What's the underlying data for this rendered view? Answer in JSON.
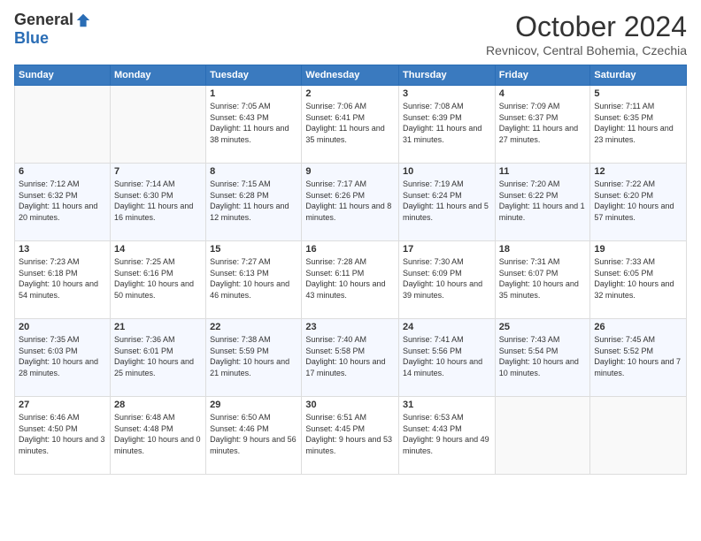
{
  "header": {
    "logo_general": "General",
    "logo_blue": "Blue",
    "title": "October 2024",
    "subtitle": "Revnicov, Central Bohemia, Czechia"
  },
  "days_of_week": [
    "Sunday",
    "Monday",
    "Tuesday",
    "Wednesday",
    "Thursday",
    "Friday",
    "Saturday"
  ],
  "weeks": [
    [
      {
        "day": "",
        "sunrise": "",
        "sunset": "",
        "daylight": ""
      },
      {
        "day": "",
        "sunrise": "",
        "sunset": "",
        "daylight": ""
      },
      {
        "day": "1",
        "sunrise": "Sunrise: 7:05 AM",
        "sunset": "Sunset: 6:43 PM",
        "daylight": "Daylight: 11 hours and 38 minutes."
      },
      {
        "day": "2",
        "sunrise": "Sunrise: 7:06 AM",
        "sunset": "Sunset: 6:41 PM",
        "daylight": "Daylight: 11 hours and 35 minutes."
      },
      {
        "day": "3",
        "sunrise": "Sunrise: 7:08 AM",
        "sunset": "Sunset: 6:39 PM",
        "daylight": "Daylight: 11 hours and 31 minutes."
      },
      {
        "day": "4",
        "sunrise": "Sunrise: 7:09 AM",
        "sunset": "Sunset: 6:37 PM",
        "daylight": "Daylight: 11 hours and 27 minutes."
      },
      {
        "day": "5",
        "sunrise": "Sunrise: 7:11 AM",
        "sunset": "Sunset: 6:35 PM",
        "daylight": "Daylight: 11 hours and 23 minutes."
      }
    ],
    [
      {
        "day": "6",
        "sunrise": "Sunrise: 7:12 AM",
        "sunset": "Sunset: 6:32 PM",
        "daylight": "Daylight: 11 hours and 20 minutes."
      },
      {
        "day": "7",
        "sunrise": "Sunrise: 7:14 AM",
        "sunset": "Sunset: 6:30 PM",
        "daylight": "Daylight: 11 hours and 16 minutes."
      },
      {
        "day": "8",
        "sunrise": "Sunrise: 7:15 AM",
        "sunset": "Sunset: 6:28 PM",
        "daylight": "Daylight: 11 hours and 12 minutes."
      },
      {
        "day": "9",
        "sunrise": "Sunrise: 7:17 AM",
        "sunset": "Sunset: 6:26 PM",
        "daylight": "Daylight: 11 hours and 8 minutes."
      },
      {
        "day": "10",
        "sunrise": "Sunrise: 7:19 AM",
        "sunset": "Sunset: 6:24 PM",
        "daylight": "Daylight: 11 hours and 5 minutes."
      },
      {
        "day": "11",
        "sunrise": "Sunrise: 7:20 AM",
        "sunset": "Sunset: 6:22 PM",
        "daylight": "Daylight: 11 hours and 1 minute."
      },
      {
        "day": "12",
        "sunrise": "Sunrise: 7:22 AM",
        "sunset": "Sunset: 6:20 PM",
        "daylight": "Daylight: 10 hours and 57 minutes."
      }
    ],
    [
      {
        "day": "13",
        "sunrise": "Sunrise: 7:23 AM",
        "sunset": "Sunset: 6:18 PM",
        "daylight": "Daylight: 10 hours and 54 minutes."
      },
      {
        "day": "14",
        "sunrise": "Sunrise: 7:25 AM",
        "sunset": "Sunset: 6:16 PM",
        "daylight": "Daylight: 10 hours and 50 minutes."
      },
      {
        "day": "15",
        "sunrise": "Sunrise: 7:27 AM",
        "sunset": "Sunset: 6:13 PM",
        "daylight": "Daylight: 10 hours and 46 minutes."
      },
      {
        "day": "16",
        "sunrise": "Sunrise: 7:28 AM",
        "sunset": "Sunset: 6:11 PM",
        "daylight": "Daylight: 10 hours and 43 minutes."
      },
      {
        "day": "17",
        "sunrise": "Sunrise: 7:30 AM",
        "sunset": "Sunset: 6:09 PM",
        "daylight": "Daylight: 10 hours and 39 minutes."
      },
      {
        "day": "18",
        "sunrise": "Sunrise: 7:31 AM",
        "sunset": "Sunset: 6:07 PM",
        "daylight": "Daylight: 10 hours and 35 minutes."
      },
      {
        "day": "19",
        "sunrise": "Sunrise: 7:33 AM",
        "sunset": "Sunset: 6:05 PM",
        "daylight": "Daylight: 10 hours and 32 minutes."
      }
    ],
    [
      {
        "day": "20",
        "sunrise": "Sunrise: 7:35 AM",
        "sunset": "Sunset: 6:03 PM",
        "daylight": "Daylight: 10 hours and 28 minutes."
      },
      {
        "day": "21",
        "sunrise": "Sunrise: 7:36 AM",
        "sunset": "Sunset: 6:01 PM",
        "daylight": "Daylight: 10 hours and 25 minutes."
      },
      {
        "day": "22",
        "sunrise": "Sunrise: 7:38 AM",
        "sunset": "Sunset: 5:59 PM",
        "daylight": "Daylight: 10 hours and 21 minutes."
      },
      {
        "day": "23",
        "sunrise": "Sunrise: 7:40 AM",
        "sunset": "Sunset: 5:58 PM",
        "daylight": "Daylight: 10 hours and 17 minutes."
      },
      {
        "day": "24",
        "sunrise": "Sunrise: 7:41 AM",
        "sunset": "Sunset: 5:56 PM",
        "daylight": "Daylight: 10 hours and 14 minutes."
      },
      {
        "day": "25",
        "sunrise": "Sunrise: 7:43 AM",
        "sunset": "Sunset: 5:54 PM",
        "daylight": "Daylight: 10 hours and 10 minutes."
      },
      {
        "day": "26",
        "sunrise": "Sunrise: 7:45 AM",
        "sunset": "Sunset: 5:52 PM",
        "daylight": "Daylight: 10 hours and 7 minutes."
      }
    ],
    [
      {
        "day": "27",
        "sunrise": "Sunrise: 6:46 AM",
        "sunset": "Sunset: 4:50 PM",
        "daylight": "Daylight: 10 hours and 3 minutes."
      },
      {
        "day": "28",
        "sunrise": "Sunrise: 6:48 AM",
        "sunset": "Sunset: 4:48 PM",
        "daylight": "Daylight: 10 hours and 0 minutes."
      },
      {
        "day": "29",
        "sunrise": "Sunrise: 6:50 AM",
        "sunset": "Sunset: 4:46 PM",
        "daylight": "Daylight: 9 hours and 56 minutes."
      },
      {
        "day": "30",
        "sunrise": "Sunrise: 6:51 AM",
        "sunset": "Sunset: 4:45 PM",
        "daylight": "Daylight: 9 hours and 53 minutes."
      },
      {
        "day": "31",
        "sunrise": "Sunrise: 6:53 AM",
        "sunset": "Sunset: 4:43 PM",
        "daylight": "Daylight: 9 hours and 49 minutes."
      },
      {
        "day": "",
        "sunrise": "",
        "sunset": "",
        "daylight": ""
      },
      {
        "day": "",
        "sunrise": "",
        "sunset": "",
        "daylight": ""
      }
    ]
  ]
}
